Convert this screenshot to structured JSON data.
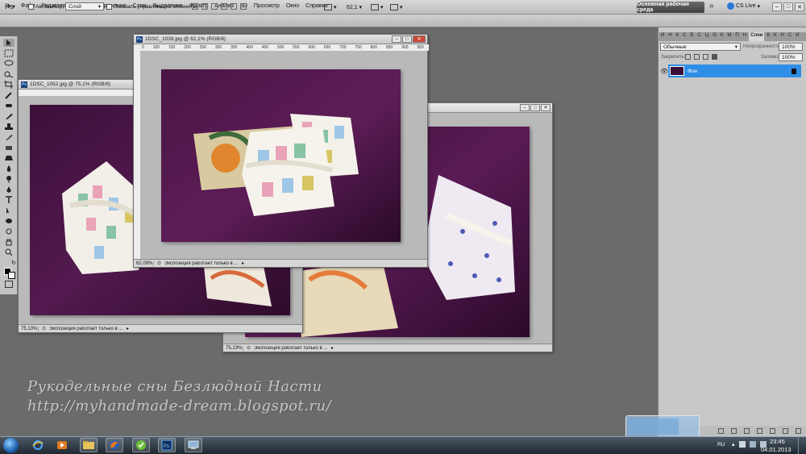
{
  "menu": {
    "items": [
      "Файл",
      "Редактирование",
      "Изображение",
      "Слои",
      "Выделение",
      "Фильтр",
      "Анализ",
      "3D",
      "Просмотр",
      "Окно",
      "Справка"
    ],
    "zoom_value": "62,1",
    "workspace_button": "Основная рабочая среда",
    "more": "»",
    "cs_live": "CS Live"
  },
  "options": {
    "auto_select_label": "Автовыбор:",
    "auto_select_value": "Слой",
    "show_controls_label": "Показать управляющие элементы"
  },
  "documents": {
    "doc1": {
      "title": "1DSC_1052.jpg @ 75,1% (RGB/8)",
      "zoom": "75,13%",
      "status": "Экспозиция работает только в ..."
    },
    "doc2": {
      "title": "1DSC_1039.jpg @ 62,1% (RGB/8)",
      "zoom": "62,09%",
      "status": "Экспозиция работает только в ...",
      "ruler_h": [
        "0",
        "100",
        "150",
        "200",
        "250",
        "300",
        "350",
        "400",
        "450",
        "500",
        "550",
        "600",
        "650",
        "700",
        "750",
        "800",
        "850",
        "900",
        "950"
      ]
    },
    "doc3": {
      "zoom": "75,13%",
      "status": "Экспозиция работает только в ..."
    }
  },
  "layers_panel": {
    "tabs": [
      "И",
      "Н",
      "К",
      "С",
      "Б",
      "С",
      "Ц",
      "О",
      "К",
      "М",
      "П",
      "Н",
      "Слои",
      "К",
      "К",
      "Н",
      "С",
      "И"
    ],
    "active_tab": "Слои",
    "blend_mode": "Обычные",
    "opacity_label": "Непрозрачность:",
    "opacity_value": "100%",
    "lock_label": "Закрепить:",
    "fill_label": "Заливка:",
    "fill_value": "100%",
    "layer_name": "Фон"
  },
  "watermark": {
    "line1": "Рукодельные сны Безлюдной Насти",
    "line2": "http://myhandmade-dream.blogspot.ru/"
  },
  "taskbar": {
    "lang": "RU",
    "time": "23:45",
    "date": "04.01.2013"
  },
  "colors": {
    "purple_fabric": "#4a1646",
    "layer_selected": "#2f8fe6",
    "workspace_bg": "#6b6b6b"
  }
}
